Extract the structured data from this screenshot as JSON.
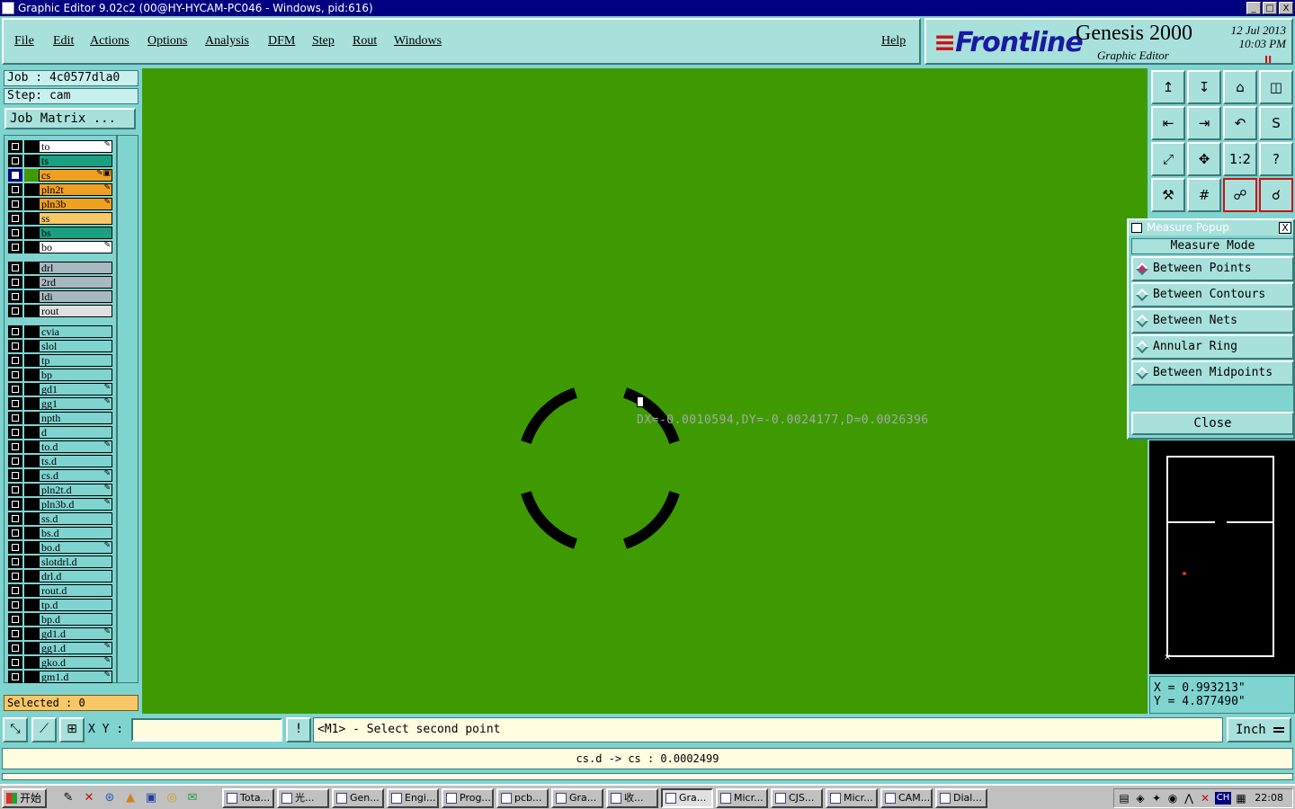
{
  "window": {
    "title": "Graphic Editor 9.02c2 (00@HY-HYCAM-PC046 - Windows, pid:616)",
    "controls": [
      "_",
      "□",
      "X"
    ]
  },
  "menu": {
    "items": [
      "File",
      "Edit",
      "Actions",
      "Options",
      "Analysis",
      "DFM",
      "Step",
      "Rout",
      "Windows"
    ],
    "help": "Help"
  },
  "brand": {
    "logo_mark": "≡",
    "logo": "Frontline",
    "product": "Genesis 2000",
    "subtitle": "Graphic Editor",
    "date": "12 Jul 2013",
    "time": "10:03 PM",
    "indicator": "II"
  },
  "job": {
    "job_label": "Job : 4c0577dla0",
    "step_label": "Step: cam",
    "matrix_button": "Job Matrix ..."
  },
  "layers": [
    {
      "name": "to",
      "color": "#ffffff",
      "mark": "✎",
      "selected": false,
      "swatch": "#000000"
    },
    {
      "name": "ts",
      "color": "#1aa080",
      "mark": "",
      "selected": false,
      "swatch": "#000000"
    },
    {
      "name": "cs",
      "color": "#f0a020",
      "mark": "✎▣",
      "selected": true,
      "swatch": "#3e9a00"
    },
    {
      "name": "pln2t",
      "color": "#f0a020",
      "mark": "✎",
      "selected": false,
      "swatch": "#000000"
    },
    {
      "name": "pln3b",
      "color": "#f0a020",
      "mark": "✎",
      "selected": false,
      "swatch": "#000000"
    },
    {
      "name": "ss",
      "color": "#f8c868",
      "mark": "",
      "selected": false,
      "swatch": "#000000"
    },
    {
      "name": "bs",
      "color": "#1aa080",
      "mark": "",
      "selected": false,
      "swatch": "#000000"
    },
    {
      "name": "bo",
      "color": "#ffffff",
      "mark": "✎",
      "selected": false,
      "swatch": "#000000"
    },
    {
      "name": "drl",
      "color": "#a8b8c0",
      "mark": "",
      "selected": false,
      "swatch": "#000000"
    },
    {
      "name": "2rd",
      "color": "#a8b8c0",
      "mark": "",
      "selected": false,
      "swatch": "#000000"
    },
    {
      "name": "ldi",
      "color": "#a8b8c0",
      "mark": "",
      "selected": false,
      "swatch": "#000000"
    },
    {
      "name": "rout",
      "color": "#e0e0e0",
      "mark": "",
      "selected": false,
      "swatch": "#000000"
    },
    {
      "name": "cvia",
      "color": "#7fd4d0",
      "mark": "",
      "selected": false,
      "swatch": "#000000"
    },
    {
      "name": "slol",
      "color": "#7fd4d0",
      "mark": "",
      "selected": false,
      "swatch": "#000000"
    },
    {
      "name": "tp",
      "color": "#7fd4d0",
      "mark": "",
      "selected": false,
      "swatch": "#000000"
    },
    {
      "name": "bp",
      "color": "#7fd4d0",
      "mark": "",
      "selected": false,
      "swatch": "#000000"
    },
    {
      "name": "gd1",
      "color": "#7fd4d0",
      "mark": "✎",
      "selected": false,
      "swatch": "#000000"
    },
    {
      "name": "gg1",
      "color": "#7fd4d0",
      "mark": "✎",
      "selected": false,
      "swatch": "#000000"
    },
    {
      "name": "npth",
      "color": "#7fd4d0",
      "mark": "",
      "selected": false,
      "swatch": "#000000"
    },
    {
      "name": "d",
      "color": "#7fd4d0",
      "mark": "",
      "selected": false,
      "swatch": "#000000"
    },
    {
      "name": "to.d",
      "color": "#7fd4d0",
      "mark": "✎",
      "selected": false,
      "swatch": "#000000"
    },
    {
      "name": "ts.d",
      "color": "#7fd4d0",
      "mark": "",
      "selected": false,
      "swatch": "#000000"
    },
    {
      "name": "cs.d",
      "color": "#7fd4d0",
      "mark": "✎",
      "selected": false,
      "swatch": "#000000"
    },
    {
      "name": "pln2t.d",
      "color": "#7fd4d0",
      "mark": "✎",
      "selected": false,
      "swatch": "#000000"
    },
    {
      "name": "pln3b.d",
      "color": "#7fd4d0",
      "mark": "✎",
      "selected": false,
      "swatch": "#000000"
    },
    {
      "name": "ss.d",
      "color": "#7fd4d0",
      "mark": "",
      "selected": false,
      "swatch": "#000000"
    },
    {
      "name": "bs.d",
      "color": "#7fd4d0",
      "mark": "",
      "selected": false,
      "swatch": "#000000"
    },
    {
      "name": "bo.d",
      "color": "#7fd4d0",
      "mark": "✎",
      "selected": false,
      "swatch": "#000000"
    },
    {
      "name": "slotdrl.d",
      "color": "#7fd4d0",
      "mark": "",
      "selected": false,
      "swatch": "#000000"
    },
    {
      "name": "drl.d",
      "color": "#7fd4d0",
      "mark": "",
      "selected": false,
      "swatch": "#000000"
    },
    {
      "name": "rout.d",
      "color": "#7fd4d0",
      "mark": "",
      "selected": false,
      "swatch": "#000000"
    },
    {
      "name": "tp.d",
      "color": "#7fd4d0",
      "mark": "",
      "selected": false,
      "swatch": "#000000"
    },
    {
      "name": "bp.d",
      "color": "#7fd4d0",
      "mark": "",
      "selected": false,
      "swatch": "#000000"
    },
    {
      "name": "gd1.d",
      "color": "#7fd4d0",
      "mark": "✎",
      "selected": false,
      "swatch": "#000000"
    },
    {
      "name": "gg1.d",
      "color": "#7fd4d0",
      "mark": "✎",
      "selected": false,
      "swatch": "#000000"
    },
    {
      "name": "gko.d",
      "color": "#7fd4d0",
      "mark": "✎",
      "selected": false,
      "swatch": "#000000"
    },
    {
      "name": "gm1.d",
      "color": "#7fd4d0",
      "mark": "✎",
      "selected": false,
      "swatch": "#000000"
    }
  ],
  "selected_label": "Selected : 0",
  "canvas": {
    "background": "#3e9a00",
    "measure_text": "DX=-0.0010594,DY=-0.0024177,D=0.0026396"
  },
  "tools": [
    {
      "name": "open-step-tool",
      "glyph": "↥",
      "highlight": false
    },
    {
      "name": "save-tool",
      "glyph": "↧",
      "highlight": false
    },
    {
      "name": "home-tool",
      "glyph": "⌂",
      "highlight": false
    },
    {
      "name": "window-tool",
      "glyph": "◫",
      "highlight": false
    },
    {
      "name": "pan-left-tool",
      "glyph": "⇤",
      "highlight": false
    },
    {
      "name": "pan-right-tool",
      "glyph": "⇥",
      "highlight": false
    },
    {
      "name": "undo-tool",
      "glyph": "↶",
      "highlight": false
    },
    {
      "name": "snap-tool",
      "glyph": "S",
      "highlight": false
    },
    {
      "name": "zoom-fit-tool",
      "glyph": "⤢",
      "highlight": false
    },
    {
      "name": "zoom-home-tool",
      "glyph": "✥",
      "highlight": false
    },
    {
      "name": "scale-tool",
      "glyph": "1:2",
      "highlight": false
    },
    {
      "name": "help-tool",
      "glyph": "?",
      "highlight": false
    },
    {
      "name": "measure-tool",
      "glyph": "⚒",
      "highlight": false
    },
    {
      "name": "grid-tool",
      "glyph": "#",
      "highlight": false
    },
    {
      "name": "netlist-tool",
      "glyph": "☍",
      "highlight": true
    },
    {
      "name": "connect-tool",
      "glyph": "☌",
      "highlight": true
    }
  ],
  "popup": {
    "title": "Measure Popup",
    "close_x": "X",
    "mode_label": "Measure Mode",
    "options": [
      {
        "label": "Between Points",
        "on": true
      },
      {
        "label": "Between Contours",
        "on": false
      },
      {
        "label": "Between Nets",
        "on": false
      },
      {
        "label": "Annular Ring",
        "on": false
      },
      {
        "label": "Between Midpoints",
        "on": false
      }
    ],
    "close_label": "Close"
  },
  "coords": {
    "x": "X = 0.993213\"",
    "y": "Y = 4.877490\""
  },
  "cmdbar": {
    "xy_label": "X Y :",
    "xy_value": "",
    "bang": "!",
    "prompt": "<M1> - Select second point",
    "unit": "Inch"
  },
  "status": {
    "text": "cs.d -> cs : 0.0002499"
  },
  "taskbar": {
    "start": "开始",
    "tasks": [
      "Tota...",
      "光...",
      "Gen...",
      "Engi...",
      "Prog...",
      "pcb...",
      "Gra...",
      "收...",
      "Gra...",
      "Micr...",
      "CJS...",
      "Micr...",
      "CAM...",
      "Dial..."
    ],
    "active_index": 8,
    "lang": "CH",
    "clock": "22:08"
  }
}
